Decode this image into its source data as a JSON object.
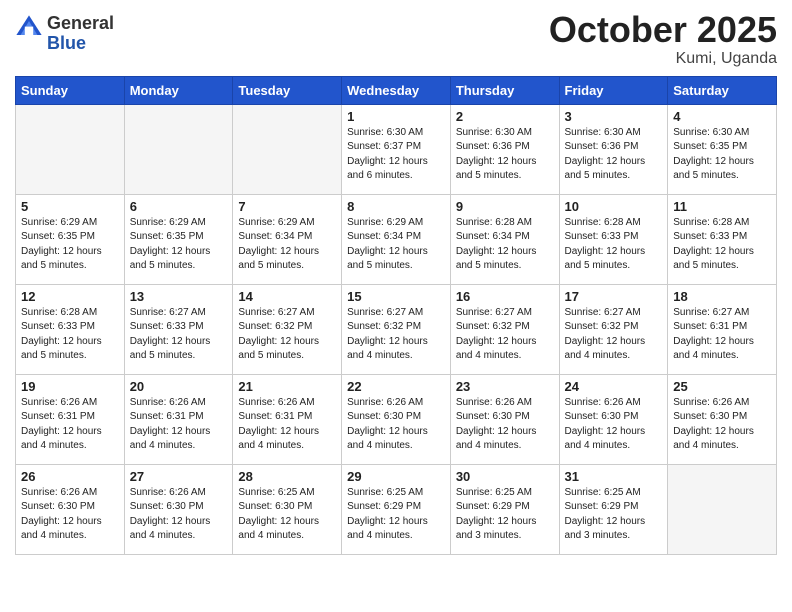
{
  "header": {
    "logo_general": "General",
    "logo_blue": "Blue",
    "month": "October 2025",
    "location": "Kumi, Uganda"
  },
  "days_of_week": [
    "Sunday",
    "Monday",
    "Tuesday",
    "Wednesday",
    "Thursday",
    "Friday",
    "Saturday"
  ],
  "weeks": [
    [
      {
        "day": "",
        "info": ""
      },
      {
        "day": "",
        "info": ""
      },
      {
        "day": "",
        "info": ""
      },
      {
        "day": "1",
        "info": "Sunrise: 6:30 AM\nSunset: 6:37 PM\nDaylight: 12 hours\nand 6 minutes."
      },
      {
        "day": "2",
        "info": "Sunrise: 6:30 AM\nSunset: 6:36 PM\nDaylight: 12 hours\nand 5 minutes."
      },
      {
        "day": "3",
        "info": "Sunrise: 6:30 AM\nSunset: 6:36 PM\nDaylight: 12 hours\nand 5 minutes."
      },
      {
        "day": "4",
        "info": "Sunrise: 6:30 AM\nSunset: 6:35 PM\nDaylight: 12 hours\nand 5 minutes."
      }
    ],
    [
      {
        "day": "5",
        "info": "Sunrise: 6:29 AM\nSunset: 6:35 PM\nDaylight: 12 hours\nand 5 minutes."
      },
      {
        "day": "6",
        "info": "Sunrise: 6:29 AM\nSunset: 6:35 PM\nDaylight: 12 hours\nand 5 minutes."
      },
      {
        "day": "7",
        "info": "Sunrise: 6:29 AM\nSunset: 6:34 PM\nDaylight: 12 hours\nand 5 minutes."
      },
      {
        "day": "8",
        "info": "Sunrise: 6:29 AM\nSunset: 6:34 PM\nDaylight: 12 hours\nand 5 minutes."
      },
      {
        "day": "9",
        "info": "Sunrise: 6:28 AM\nSunset: 6:34 PM\nDaylight: 12 hours\nand 5 minutes."
      },
      {
        "day": "10",
        "info": "Sunrise: 6:28 AM\nSunset: 6:33 PM\nDaylight: 12 hours\nand 5 minutes."
      },
      {
        "day": "11",
        "info": "Sunrise: 6:28 AM\nSunset: 6:33 PM\nDaylight: 12 hours\nand 5 minutes."
      }
    ],
    [
      {
        "day": "12",
        "info": "Sunrise: 6:28 AM\nSunset: 6:33 PM\nDaylight: 12 hours\nand 5 minutes."
      },
      {
        "day": "13",
        "info": "Sunrise: 6:27 AM\nSunset: 6:33 PM\nDaylight: 12 hours\nand 5 minutes."
      },
      {
        "day": "14",
        "info": "Sunrise: 6:27 AM\nSunset: 6:32 PM\nDaylight: 12 hours\nand 5 minutes."
      },
      {
        "day": "15",
        "info": "Sunrise: 6:27 AM\nSunset: 6:32 PM\nDaylight: 12 hours\nand 4 minutes."
      },
      {
        "day": "16",
        "info": "Sunrise: 6:27 AM\nSunset: 6:32 PM\nDaylight: 12 hours\nand 4 minutes."
      },
      {
        "day": "17",
        "info": "Sunrise: 6:27 AM\nSunset: 6:32 PM\nDaylight: 12 hours\nand 4 minutes."
      },
      {
        "day": "18",
        "info": "Sunrise: 6:27 AM\nSunset: 6:31 PM\nDaylight: 12 hours\nand 4 minutes."
      }
    ],
    [
      {
        "day": "19",
        "info": "Sunrise: 6:26 AM\nSunset: 6:31 PM\nDaylight: 12 hours\nand 4 minutes."
      },
      {
        "day": "20",
        "info": "Sunrise: 6:26 AM\nSunset: 6:31 PM\nDaylight: 12 hours\nand 4 minutes."
      },
      {
        "day": "21",
        "info": "Sunrise: 6:26 AM\nSunset: 6:31 PM\nDaylight: 12 hours\nand 4 minutes."
      },
      {
        "day": "22",
        "info": "Sunrise: 6:26 AM\nSunset: 6:30 PM\nDaylight: 12 hours\nand 4 minutes."
      },
      {
        "day": "23",
        "info": "Sunrise: 6:26 AM\nSunset: 6:30 PM\nDaylight: 12 hours\nand 4 minutes."
      },
      {
        "day": "24",
        "info": "Sunrise: 6:26 AM\nSunset: 6:30 PM\nDaylight: 12 hours\nand 4 minutes."
      },
      {
        "day": "25",
        "info": "Sunrise: 6:26 AM\nSunset: 6:30 PM\nDaylight: 12 hours\nand 4 minutes."
      }
    ],
    [
      {
        "day": "26",
        "info": "Sunrise: 6:26 AM\nSunset: 6:30 PM\nDaylight: 12 hours\nand 4 minutes."
      },
      {
        "day": "27",
        "info": "Sunrise: 6:26 AM\nSunset: 6:30 PM\nDaylight: 12 hours\nand 4 minutes."
      },
      {
        "day": "28",
        "info": "Sunrise: 6:25 AM\nSunset: 6:30 PM\nDaylight: 12 hours\nand 4 minutes."
      },
      {
        "day": "29",
        "info": "Sunrise: 6:25 AM\nSunset: 6:29 PM\nDaylight: 12 hours\nand 4 minutes."
      },
      {
        "day": "30",
        "info": "Sunrise: 6:25 AM\nSunset: 6:29 PM\nDaylight: 12 hours\nand 3 minutes."
      },
      {
        "day": "31",
        "info": "Sunrise: 6:25 AM\nSunset: 6:29 PM\nDaylight: 12 hours\nand 3 minutes."
      },
      {
        "day": "",
        "info": ""
      }
    ]
  ]
}
